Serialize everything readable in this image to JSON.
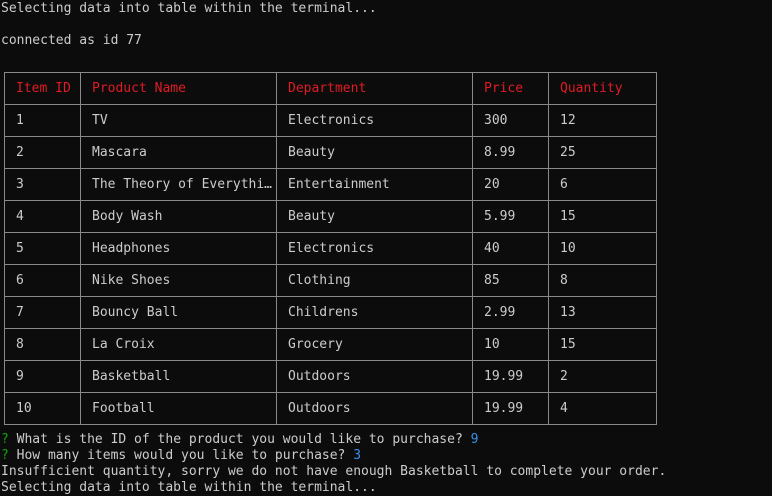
{
  "terminal": {
    "line1": "Selecting data into table within the terminal...",
    "line2": "connected as id 77"
  },
  "table": {
    "headers": [
      "Item ID",
      "Product Name",
      "Department",
      "Price",
      "Quantity"
    ],
    "rows": [
      [
        "1",
        "TV",
        "Electronics",
        "300",
        "12"
      ],
      [
        "2",
        "Mascara",
        "Beauty",
        "8.99",
        "25"
      ],
      [
        "3",
        "The Theory of Everythi…",
        "Entertainment",
        "20",
        "6"
      ],
      [
        "4",
        "Body Wash",
        "Beauty",
        "5.99",
        "15"
      ],
      [
        "5",
        "Headphones",
        "Electronics",
        "40",
        "10"
      ],
      [
        "6",
        "Nike Shoes",
        "Clothing",
        "85",
        "8"
      ],
      [
        "7",
        "Bouncy Ball",
        "Childrens",
        "2.99",
        "13"
      ],
      [
        "8",
        "La Croix",
        "Grocery",
        "10",
        "15"
      ],
      [
        "9",
        "Basketball",
        "Outdoors",
        "19.99",
        "2"
      ],
      [
        "10",
        "Football",
        "Outdoors",
        "19.99",
        "4"
      ]
    ]
  },
  "prompts": [
    {
      "marker": "?",
      "question": "What is the ID of the product you would like to purchase?",
      "answer": "9"
    },
    {
      "marker": "?",
      "question": "How many items would you like to purchase?",
      "answer": "3"
    }
  ],
  "result": "Insufficient quantity, sorry we do not have enough Basketball to complete your order.",
  "trailing": "Selecting data into table within the terminal..."
}
